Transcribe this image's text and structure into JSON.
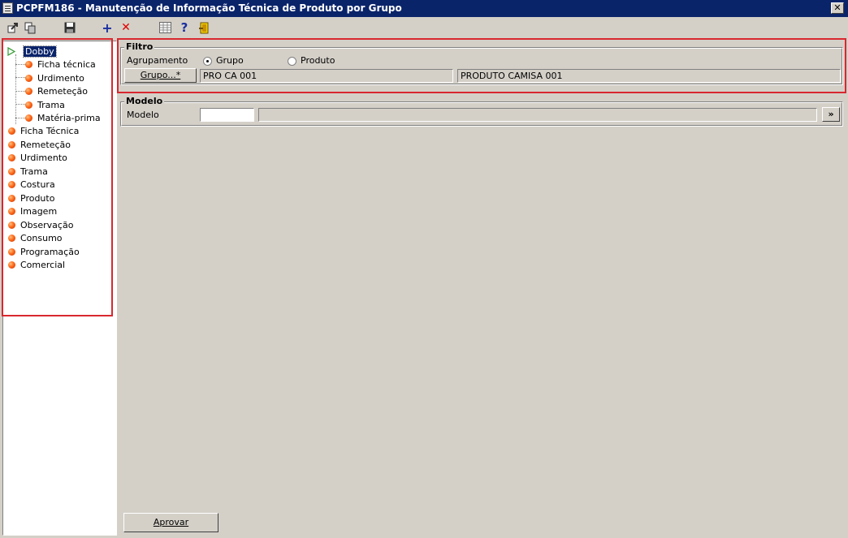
{
  "window": {
    "title": "PCPFM186 - Manutenção de Informação Técnica de Produto por Grupo",
    "close_glyph": "✕"
  },
  "toolbar": {
    "buttons": [
      {
        "icon": "export-icon"
      },
      {
        "icon": "copy-icon"
      },
      {
        "icon": "save-icon"
      },
      {
        "icon": "add-icon",
        "glyph": "+"
      },
      {
        "icon": "delete-icon",
        "glyph": "✕"
      },
      {
        "icon": "table-icon"
      },
      {
        "icon": "help-icon",
        "glyph": "?"
      },
      {
        "icon": "exit-door-icon"
      }
    ]
  },
  "tree": {
    "root": {
      "label": "Dobby",
      "children": [
        "Ficha técnica",
        "Urdimento",
        "Remeteção",
        "Trama",
        "Matéria-prima"
      ]
    },
    "items": [
      "Ficha Técnica",
      "Remeteção",
      "Urdimento",
      "Trama",
      "Costura",
      "Produto",
      "Imagem",
      "Observação",
      "Consumo",
      "Programação",
      "Comercial"
    ]
  },
  "filtro": {
    "legend": "Filtro",
    "agrupamento_label": "Agrupamento",
    "radio_grupo": "Grupo",
    "radio_produto": "Produto",
    "selected": "Grupo",
    "grupo_button": "Grupo...*",
    "code_value": "PRO CA 001",
    "description_value": "PRODUTO CAMISA 001"
  },
  "modelo": {
    "legend": "Modelo",
    "label": "Modelo",
    "code_value": "",
    "description_value": "",
    "lookup_button": "»"
  },
  "actions": {
    "approve": "Aprovar"
  },
  "colors": {
    "titlebar": "#0a246a",
    "highlight": "#d8282f",
    "tree_selected": "#0a246a",
    "panel": "#d4d0c8"
  }
}
